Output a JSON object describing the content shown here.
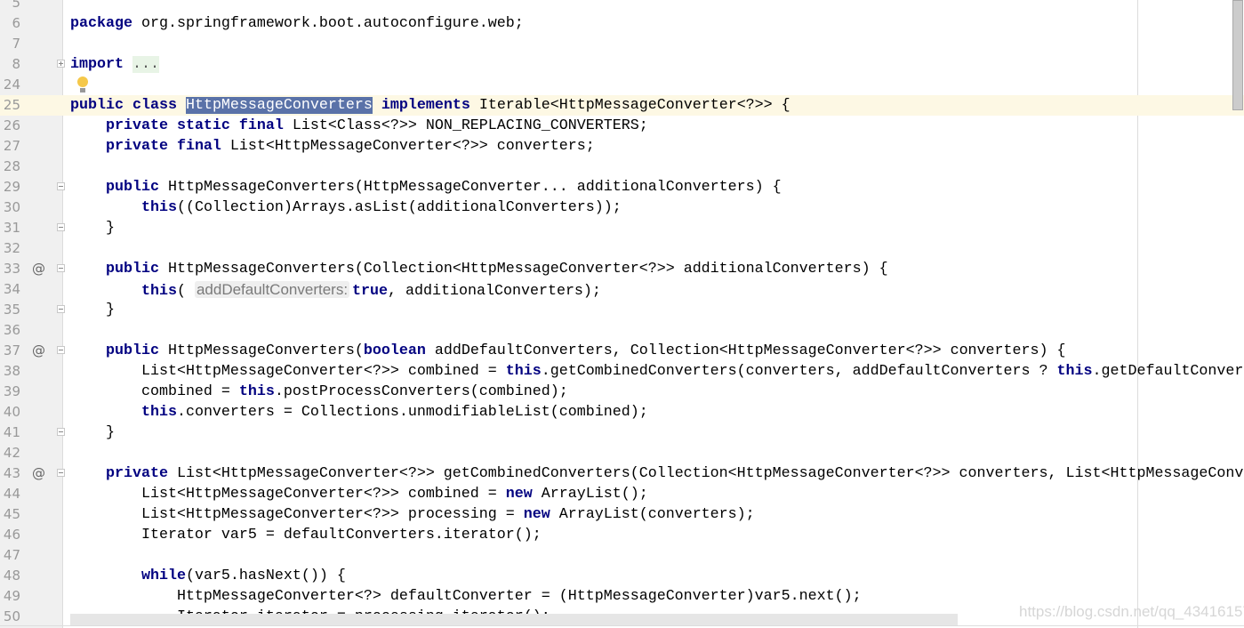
{
  "editor": {
    "current_line": 25,
    "lines": [
      {
        "n": "5",
        "tokens": []
      },
      {
        "n": "6",
        "tokens": [
          [
            "kw",
            "package"
          ],
          [
            "p",
            " org.springframework.boot.autoconfigure.web;"
          ]
        ]
      },
      {
        "n": "7",
        "tokens": []
      },
      {
        "n": "8",
        "fold": "plus",
        "tokens": [
          [
            "kw",
            "import"
          ],
          [
            "p",
            " "
          ],
          [
            "fold",
            "..."
          ]
        ]
      },
      {
        "n": "24",
        "bulb": true,
        "tokens": []
      },
      {
        "n": "25",
        "tokens": [
          [
            "kw",
            "public class"
          ],
          [
            "p",
            " "
          ],
          [
            "sel",
            "HttpMessageConverters"
          ],
          [
            "p",
            " "
          ],
          [
            "kw",
            "implements"
          ],
          [
            "p",
            " Iterable<HttpMessageConverter<?>> {"
          ]
        ]
      },
      {
        "n": "26",
        "tokens": [
          [
            "p",
            "    "
          ],
          [
            "kw",
            "private static final"
          ],
          [
            "p",
            " List<Class<?>> NON_REPLACING_CONVERTERS;"
          ]
        ]
      },
      {
        "n": "27",
        "tokens": [
          [
            "p",
            "    "
          ],
          [
            "kw",
            "private final"
          ],
          [
            "p",
            " List<HttpMessageConverter<?>> converters;"
          ]
        ]
      },
      {
        "n": "28",
        "tokens": []
      },
      {
        "n": "29",
        "fold": "minus",
        "tokens": [
          [
            "p",
            "    "
          ],
          [
            "kw",
            "public"
          ],
          [
            "p",
            " HttpMessageConverters(HttpMessageConverter... additionalConverters) {"
          ]
        ]
      },
      {
        "n": "30",
        "tokens": [
          [
            "p",
            "        "
          ],
          [
            "kw",
            "this"
          ],
          [
            "p",
            "((Collection)Arrays.asList(additionalConverters));"
          ]
        ]
      },
      {
        "n": "31",
        "fold": "minus",
        "tokens": [
          [
            "p",
            "    }"
          ]
        ]
      },
      {
        "n": "32",
        "tokens": []
      },
      {
        "n": "33",
        "mark": "@",
        "fold": "minus",
        "tokens": [
          [
            "p",
            "    "
          ],
          [
            "kw",
            "public"
          ],
          [
            "p",
            " HttpMessageConverters(Collection<HttpMessageConverter<?>> additionalConverters) {"
          ]
        ]
      },
      {
        "n": "34",
        "tokens": [
          [
            "p",
            "        "
          ],
          [
            "kw",
            "this"
          ],
          [
            "p",
            "( "
          ],
          [
            "hint",
            "addDefaultConverters:"
          ],
          [
            "kw",
            "true"
          ],
          [
            "p",
            ", additionalConverters);"
          ]
        ]
      },
      {
        "n": "35",
        "fold": "minus",
        "tokens": [
          [
            "p",
            "    }"
          ]
        ]
      },
      {
        "n": "36",
        "tokens": []
      },
      {
        "n": "37",
        "mark": "@",
        "fold": "minus",
        "tokens": [
          [
            "p",
            "    "
          ],
          [
            "kw",
            "public"
          ],
          [
            "p",
            " HttpMessageConverters("
          ],
          [
            "kw",
            "boolean"
          ],
          [
            "p",
            " addDefaultConverters, Collection<HttpMessageConverter<?>> converters) {"
          ]
        ]
      },
      {
        "n": "38",
        "tokens": [
          [
            "p",
            "        List<HttpMessageConverter<?>> combined = "
          ],
          [
            "kw",
            "this"
          ],
          [
            "p",
            ".getCombinedConverters(converters, addDefaultConverters ? "
          ],
          [
            "kw",
            "this"
          ],
          [
            "p",
            ".getDefaultConver"
          ]
        ]
      },
      {
        "n": "39",
        "tokens": [
          [
            "p",
            "        combined = "
          ],
          [
            "kw",
            "this"
          ],
          [
            "p",
            ".postProcessConverters(combined);"
          ]
        ]
      },
      {
        "n": "40",
        "tokens": [
          [
            "p",
            "        "
          ],
          [
            "kw",
            "this"
          ],
          [
            "p",
            ".converters = Collections.unmodifiableList(combined);"
          ]
        ]
      },
      {
        "n": "41",
        "fold": "minus",
        "tokens": [
          [
            "p",
            "    }"
          ]
        ]
      },
      {
        "n": "42",
        "tokens": []
      },
      {
        "n": "43",
        "mark": "@",
        "fold": "minus",
        "tokens": [
          [
            "p",
            "    "
          ],
          [
            "kw",
            "private"
          ],
          [
            "p",
            " List<HttpMessageConverter<?>> getCombinedConverters(Collection<HttpMessageConverter<?>> converters, List<HttpMessageConv"
          ]
        ]
      },
      {
        "n": "44",
        "tokens": [
          [
            "p",
            "        List<HttpMessageConverter<?>> combined = "
          ],
          [
            "kw",
            "new"
          ],
          [
            "p",
            " ArrayList();"
          ]
        ]
      },
      {
        "n": "45",
        "tokens": [
          [
            "p",
            "        List<HttpMessageConverter<?>> processing = "
          ],
          [
            "kw",
            "new"
          ],
          [
            "p",
            " ArrayList(converters);"
          ]
        ]
      },
      {
        "n": "46",
        "tokens": [
          [
            "p",
            "        Iterator var5 = defaultConverters.iterator();"
          ]
        ]
      },
      {
        "n": "47",
        "tokens": []
      },
      {
        "n": "48",
        "tokens": [
          [
            "p",
            "        "
          ],
          [
            "kw",
            "while"
          ],
          [
            "p",
            "(var5.hasNext()) {"
          ]
        ]
      },
      {
        "n": "49",
        "tokens": [
          [
            "p",
            "            HttpMessageConverter<?> defaultConverter = (HttpMessageConverter)var5.next();"
          ]
        ]
      },
      {
        "n": "50",
        "tokens": [
          [
            "p",
            "            Iterator iterator = processing.iterator();"
          ]
        ]
      }
    ]
  },
  "watermark": "https://blog.csdn.net/qq_43416157"
}
